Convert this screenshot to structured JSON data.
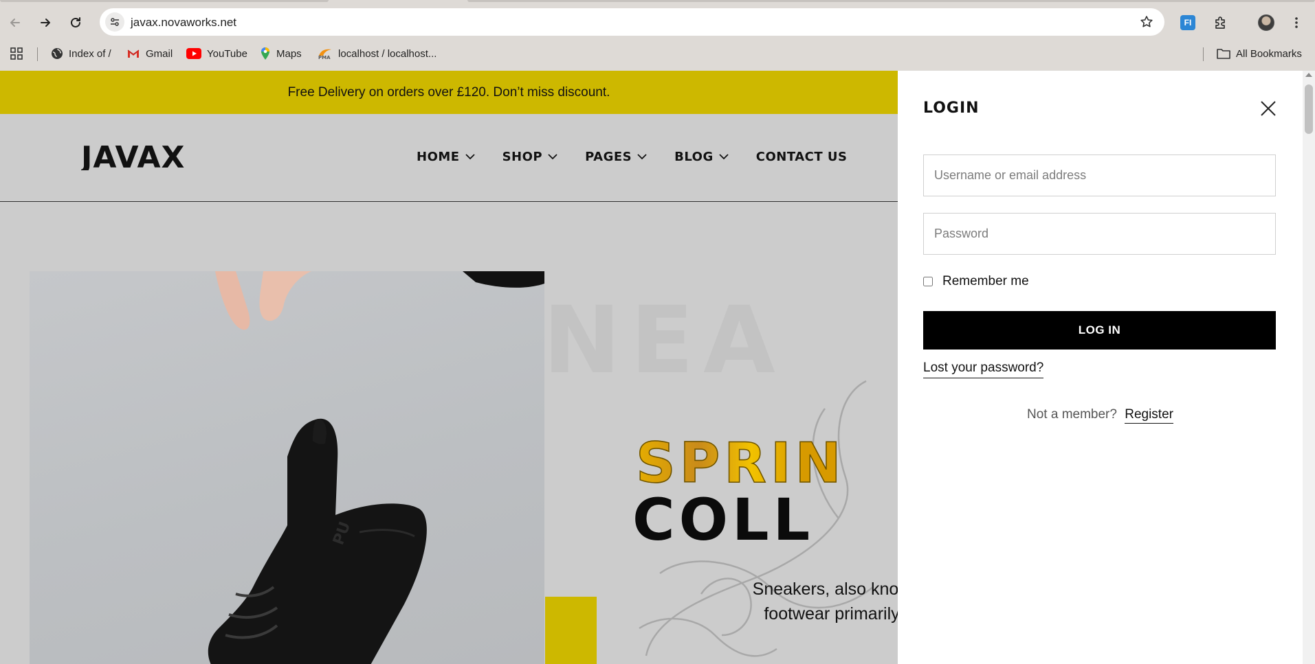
{
  "browser": {
    "url": "javax.novaworks.net",
    "bookmarks": [
      {
        "label": "Index of /",
        "icon": "globe-icon"
      },
      {
        "label": "Gmail",
        "icon": "gmail-icon"
      },
      {
        "label": "YouTube",
        "icon": "youtube-icon"
      },
      {
        "label": "Maps",
        "icon": "maps-icon"
      },
      {
        "label": "localhost / localhost...",
        "icon": "phpmyadmin-icon"
      }
    ],
    "all_bookmarks_label": "All Bookmarks",
    "extension_label": "FI"
  },
  "site": {
    "promo_text": "Free Delivery on orders over £120. Don’t miss discount.",
    "brand": "JAVAX",
    "menu": [
      {
        "label": "HOME",
        "has_dropdown": true
      },
      {
        "label": "SHOP",
        "has_dropdown": true
      },
      {
        "label": "PAGES",
        "has_dropdown": true
      },
      {
        "label": "BLOG",
        "has_dropdown": true
      },
      {
        "label": "CONTACT US",
        "has_dropdown": false
      }
    ],
    "hero": {
      "background_word": "NEA",
      "title_line1": "SPRIN",
      "title_line2": "COLL",
      "description_line1": "Sneakers, also know",
      "description_line2": "footwear primarily"
    }
  },
  "login_drawer": {
    "title": "LOGIN",
    "username_placeholder": "Username or email address",
    "password_placeholder": "Password",
    "remember_label": "Remember me",
    "remember_checked": false,
    "login_button": "LOG IN",
    "lost_password": "Lost your password?",
    "not_member_text": "Not a member?",
    "register_link": "Register"
  },
  "colors": {
    "accent_yellow": "#cdb800",
    "login_button_bg": "#000000",
    "page_bg": "#cccccc"
  }
}
